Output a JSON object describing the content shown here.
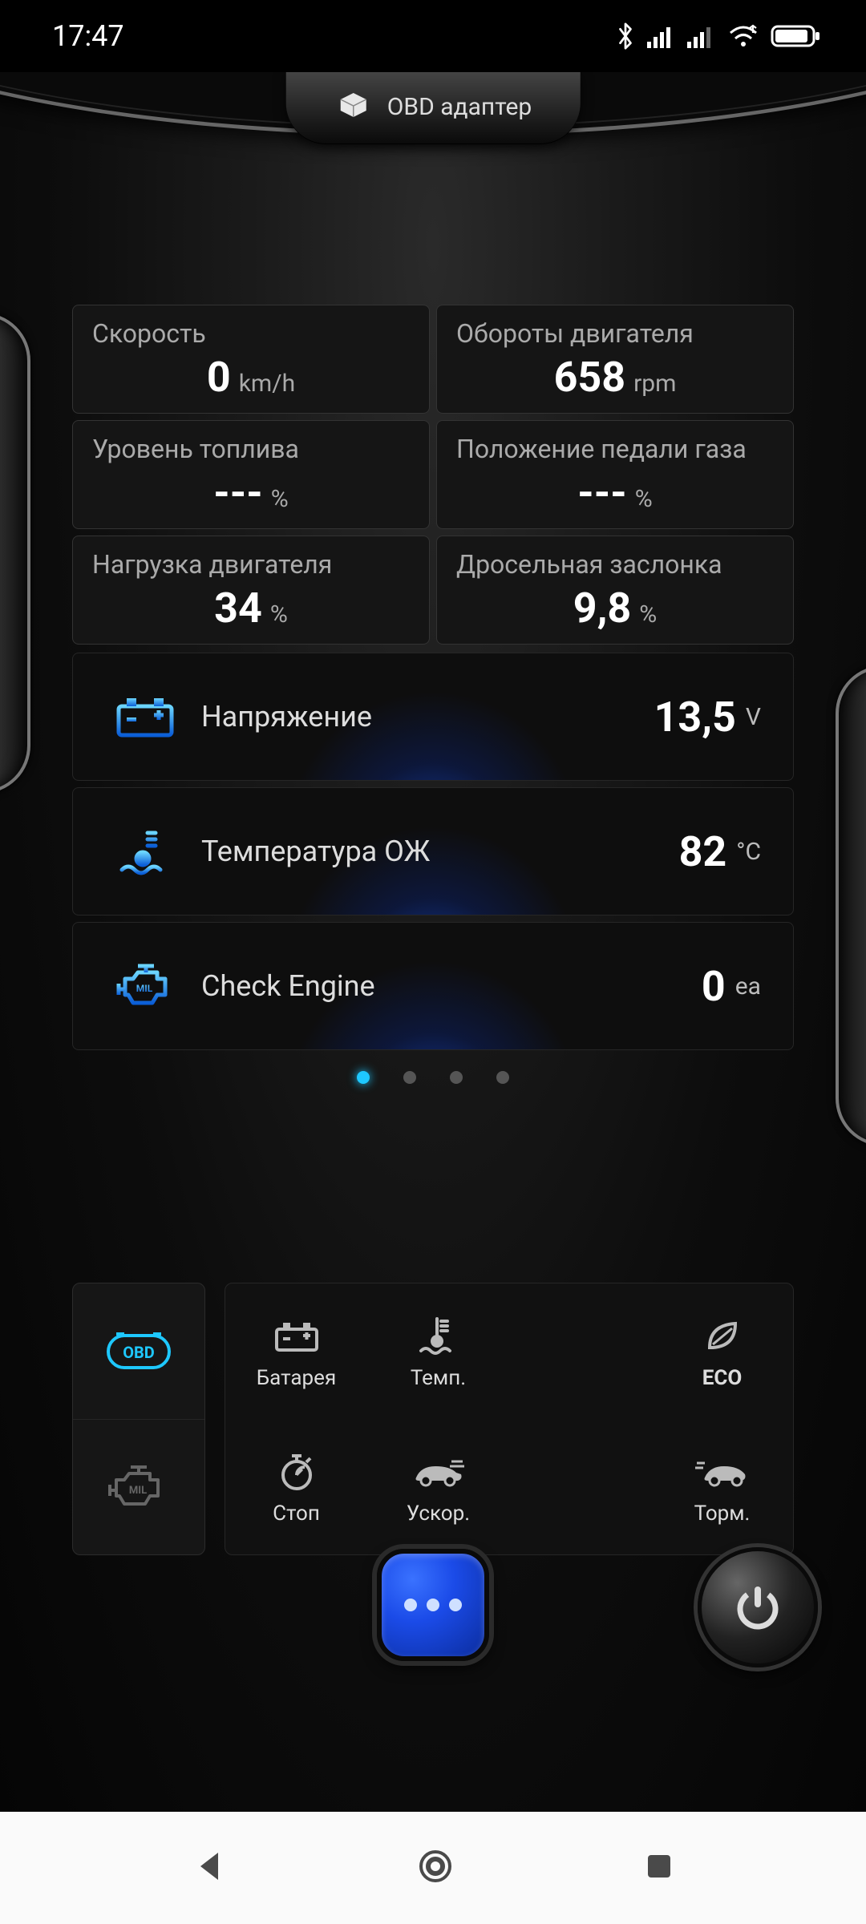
{
  "status": {
    "time": "17:47"
  },
  "header": {
    "label": "OBD адаптер"
  },
  "gauges": [
    {
      "label": "Скорость",
      "value": "0",
      "unit": "km/h"
    },
    {
      "label": "Обороты двигателя",
      "value": "658",
      "unit": "rpm"
    },
    {
      "label": "Уровень топлива",
      "value": "---",
      "unit": "%"
    },
    {
      "label": "Положение педали газа",
      "value": "---",
      "unit": "%"
    },
    {
      "label": "Нагрузка двигателя",
      "value": "34",
      "unit": "%"
    },
    {
      "label": "Дросельная заслонка",
      "value": "9,8",
      "unit": "%"
    }
  ],
  "wide": [
    {
      "label": "Напряжение",
      "value": "13,5",
      "unit": "V"
    },
    {
      "label": "Температура ОЖ",
      "value": "82",
      "unit": "°C"
    },
    {
      "label": "Check Engine",
      "value": "0",
      "unit": "ea"
    }
  ],
  "pager": {
    "count": 4,
    "active": 0
  },
  "quick": [
    {
      "label": "Батарея"
    },
    {
      "label": "Темп."
    },
    {
      "label": "ECO"
    },
    {
      "label": "Стоп"
    },
    {
      "label": "Ускор."
    },
    {
      "label": "Торм."
    }
  ]
}
